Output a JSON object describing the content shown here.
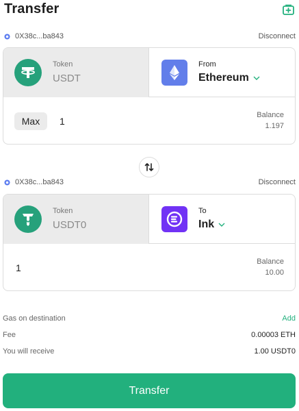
{
  "header": {
    "title": "Transfer",
    "icon": "add-wallet-icon"
  },
  "source": {
    "wallet": {
      "address": "0X38c...ba843",
      "disconnect_label": "Disconnect"
    },
    "token": {
      "label": "Token",
      "name": "USDT",
      "icon": "tether-icon"
    },
    "chain": {
      "label": "From",
      "name": "Ethereum",
      "icon": "ethereum-icon",
      "color": "#627eea"
    },
    "max_label": "Max",
    "amount": "1",
    "balance_label": "Balance",
    "balance_value": "1.197"
  },
  "destination": {
    "wallet": {
      "address": "0X38c...ba843",
      "disconnect_label": "Disconnect"
    },
    "token": {
      "label": "Token",
      "name": "USDT0",
      "icon": "usdt0-icon"
    },
    "chain": {
      "label": "To",
      "name": "Ink",
      "icon": "ink-icon",
      "color": "#7132f5"
    },
    "amount": "1",
    "balance_label": "Balance",
    "balance_value": "10.00"
  },
  "details": {
    "gas_label": "Gas on destination",
    "gas_action": "Add",
    "fee_label": "Fee",
    "fee_value": "0.00003 ETH",
    "receive_label": "You will receive",
    "receive_value": "1.00 USDT0"
  },
  "transfer_button": "Transfer",
  "colors": {
    "accent": "#22b07d",
    "tether": "#26a17b",
    "ethereum": "#627eea",
    "ink": "#7132f5",
    "wallet_dot": "#5b7cf0"
  }
}
